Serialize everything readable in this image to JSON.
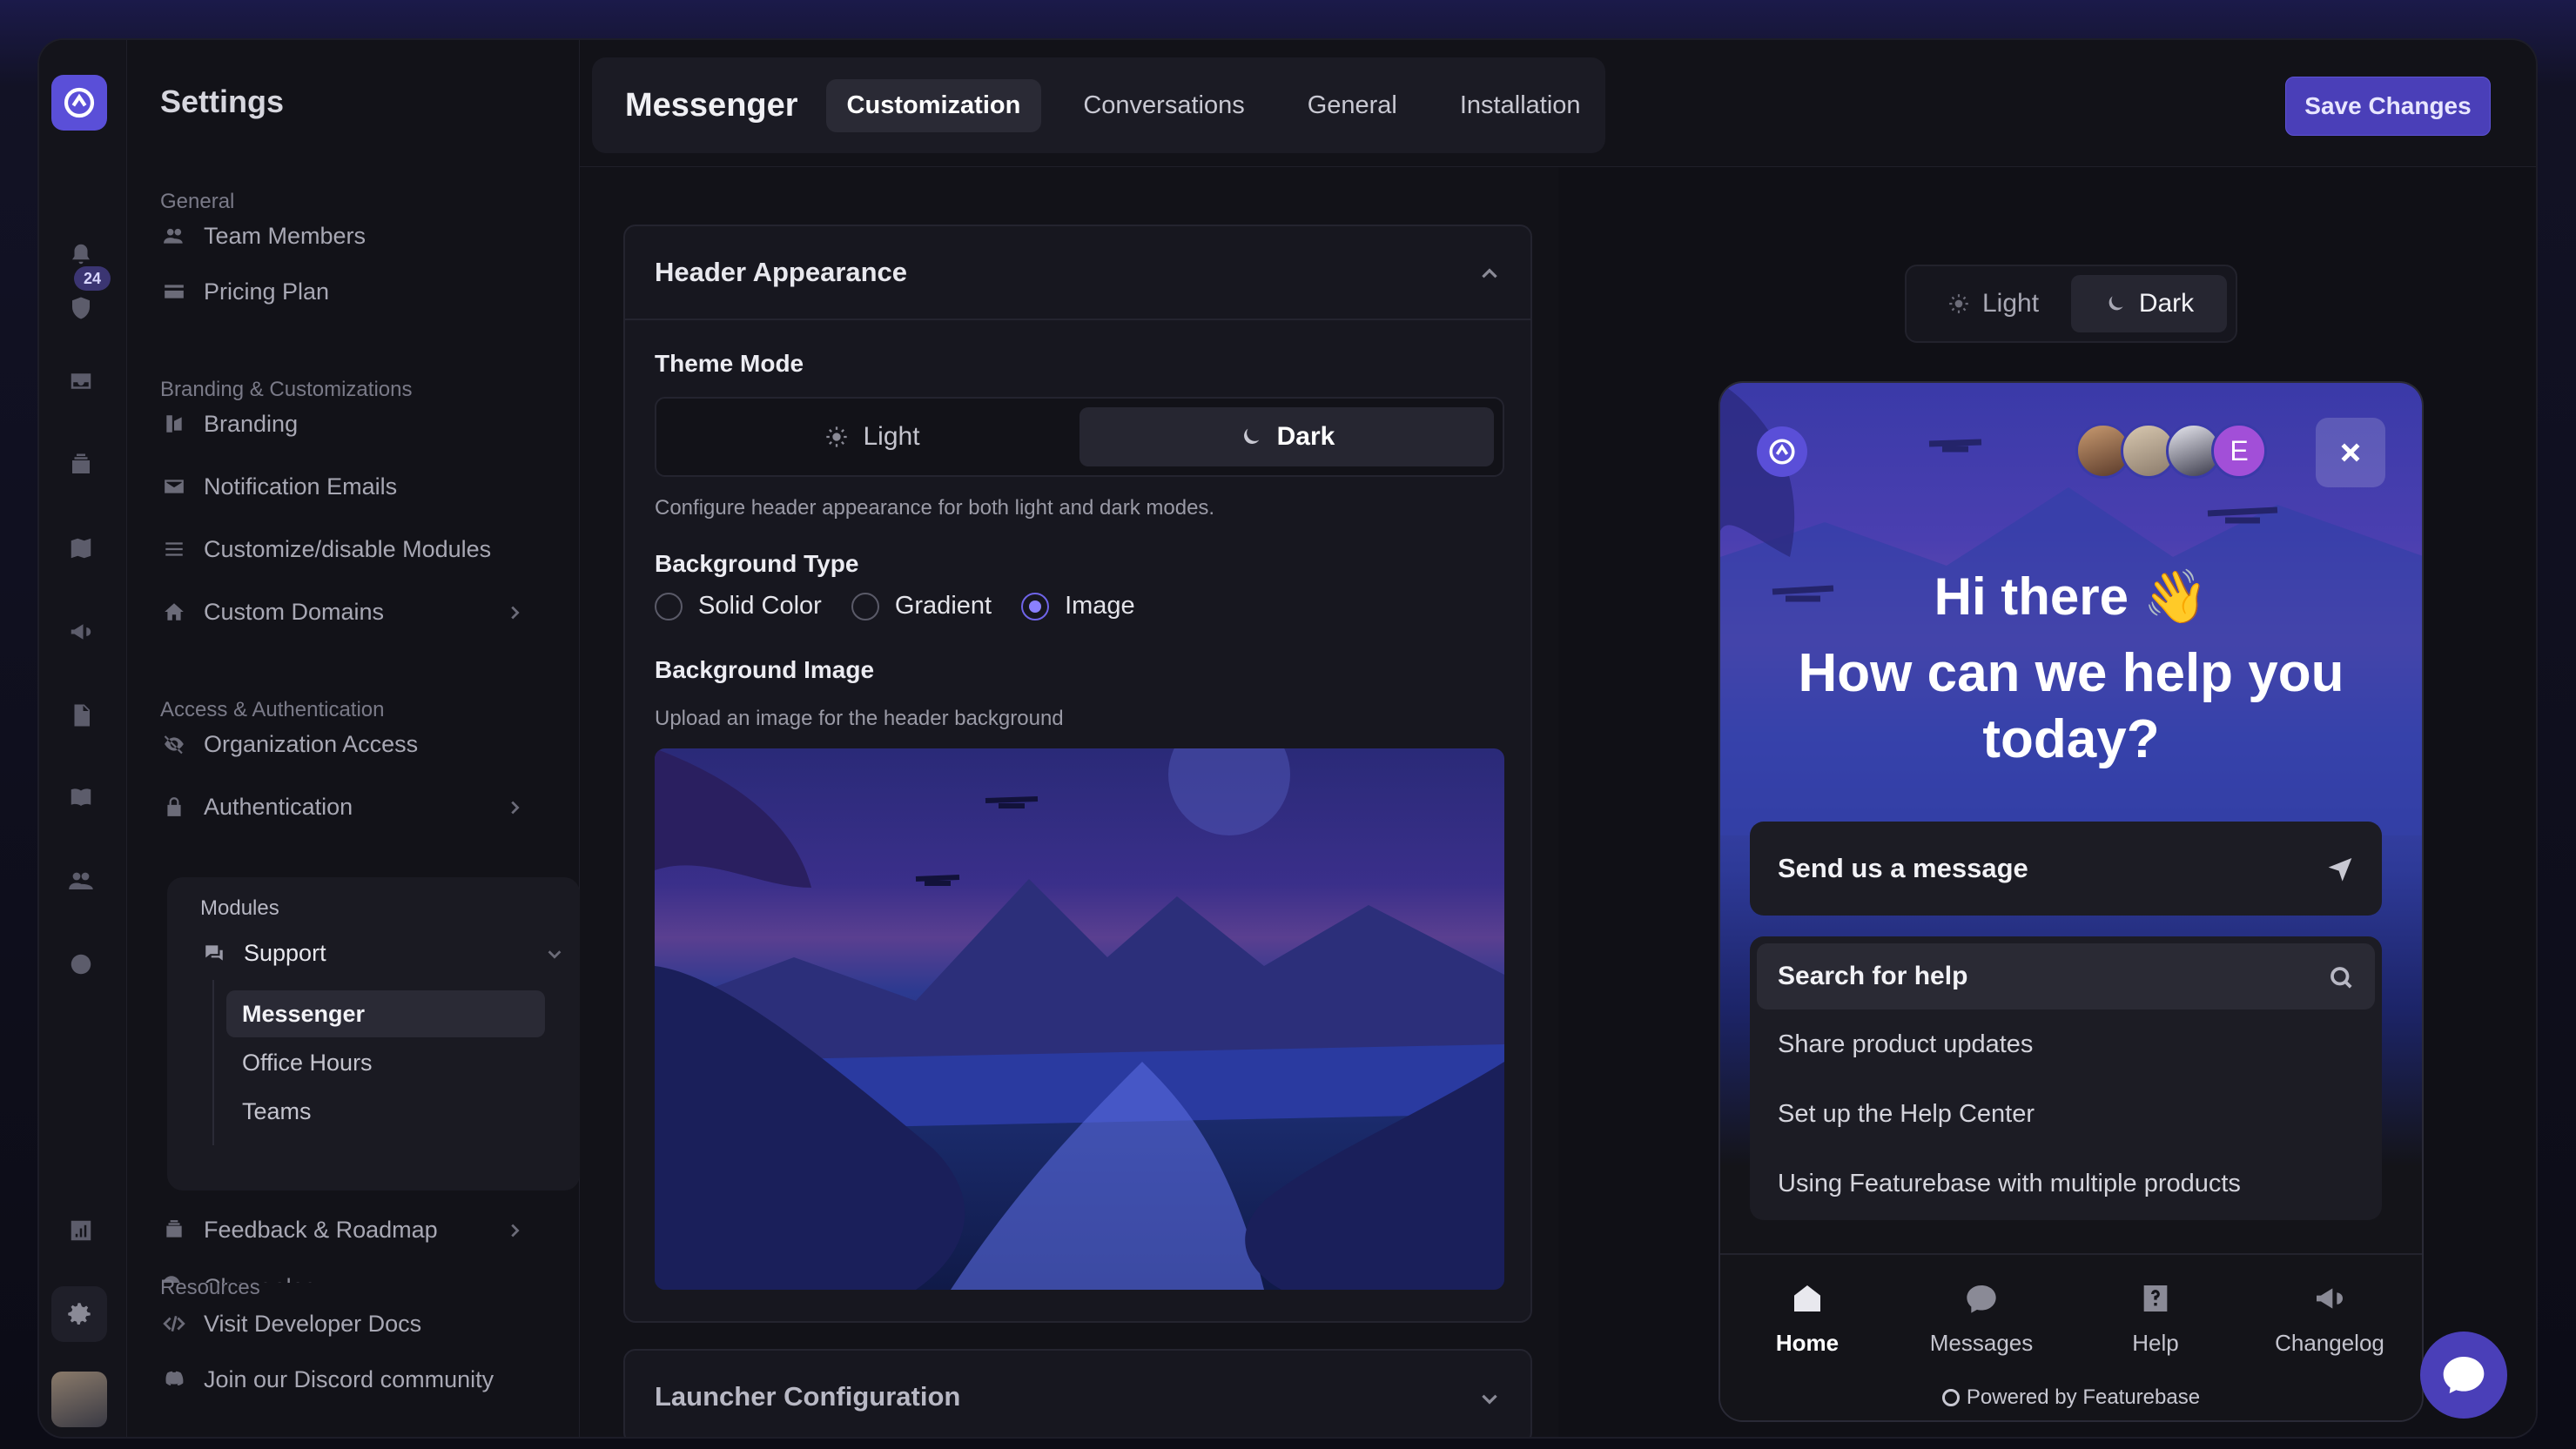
{
  "sidebar": {
    "title": "Settings",
    "badge_count": "24",
    "sections": {
      "general": "General",
      "branding": "Branding & Customizations",
      "access": "Access & Authentication",
      "modules": "Modules",
      "resources": "Resources"
    },
    "items": {
      "team_members": "Team Members",
      "pricing_plan": "Pricing Plan",
      "branding": "Branding",
      "notification_emails": "Notification Emails",
      "customize_modules": "Customize/disable Modules",
      "custom_domains": "Custom Domains",
      "organization_access": "Organization Access",
      "authentication": "Authentication",
      "support": "Support",
      "messenger": "Messenger",
      "office_hours": "Office Hours",
      "teams": "Teams",
      "feedback_roadmap": "Feedback & Roadmap",
      "changelog": "Changelog",
      "developer_docs": "Visit Developer Docs",
      "discord": "Join our Discord community"
    }
  },
  "topbar": {
    "app_title": "Messenger",
    "tabs": [
      "Customization",
      "Conversations",
      "General",
      "Installation"
    ],
    "active_tab": "Customization",
    "save_label": "Save Changes"
  },
  "editor": {
    "header_card_title": "Header Appearance",
    "theme_mode_label": "Theme Mode",
    "theme_light": "Light",
    "theme_dark": "Dark",
    "theme_help": "Configure header appearance for both light and dark modes.",
    "bg_type_label": "Background Type",
    "bg_types": [
      "Solid Color",
      "Gradient",
      "Image"
    ],
    "bg_type_selected": "Image",
    "bg_image_label": "Background Image",
    "bg_image_help": "Upload an image for the header background",
    "launcher_card_title": "Launcher Configuration"
  },
  "preview": {
    "toggle_light": "Light",
    "toggle_dark": "Dark",
    "avatar_letter": "E",
    "greeting_1": "Hi there 👋",
    "greeting_2": "How can we help you today?",
    "send_message": "Send us a message",
    "search_help": "Search for help",
    "articles": [
      "Share product updates",
      "Set up the Help Center",
      "Using Featurebase with multiple products"
    ],
    "nav": [
      "Home",
      "Messages",
      "Help",
      "Changelog"
    ],
    "powered_by": "Powered by Featurebase"
  },
  "colors": {
    "accent": "#4a3fb8",
    "background": "#121218",
    "card": "#17171f"
  }
}
